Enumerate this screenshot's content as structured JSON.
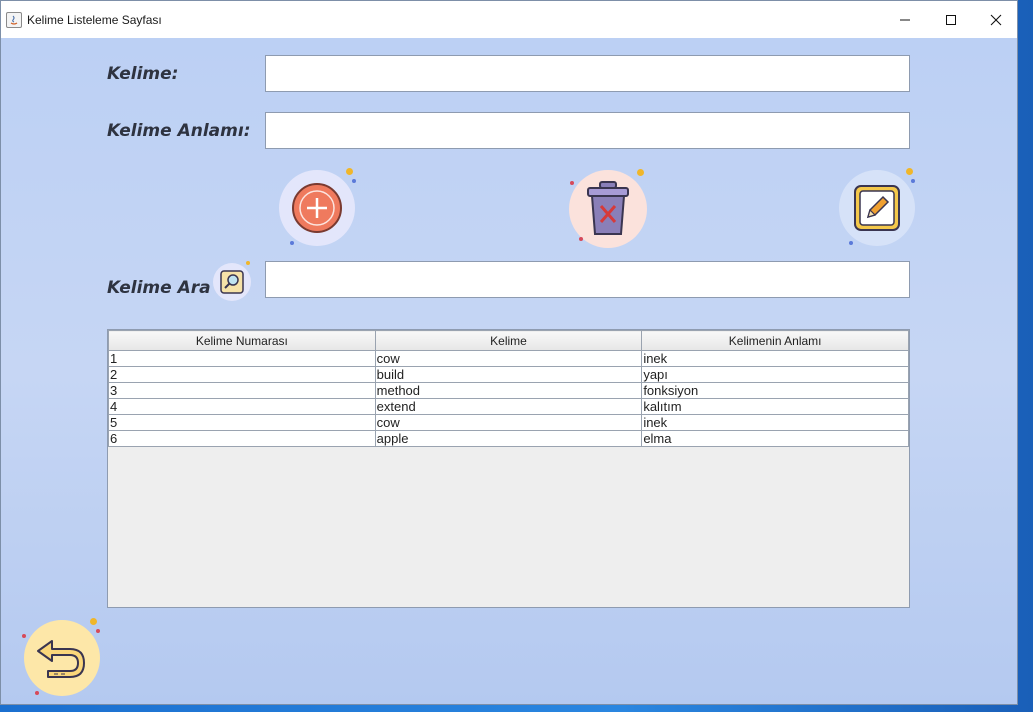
{
  "window": {
    "title": "Kelime Listeleme Sayfası",
    "controls": {
      "minimize": "minimize-icon",
      "maximize": "maximize-icon",
      "close": "close-icon"
    }
  },
  "form": {
    "word_label": "Kelime:",
    "word_value": "",
    "meaning_label": "Kelime Anlamı:",
    "meaning_value": "",
    "search_label": "Kelime Ara",
    "search_value": ""
  },
  "actions": {
    "add": "add-icon",
    "delete": "trash-delete-icon",
    "edit": "edit-pencil-icon",
    "back": "back-arrow-icon"
  },
  "table": {
    "columns": [
      "Kelime Numarası",
      "Kelime",
      "Kelimenin Anlamı"
    ],
    "rows": [
      [
        "1",
        "cow",
        "inek"
      ],
      [
        "2",
        "build",
        "yapı"
      ],
      [
        "3",
        "method",
        "fonksiyon"
      ],
      [
        "4",
        "extend",
        "kalıtım"
      ],
      [
        "5",
        "cow",
        "inek"
      ],
      [
        "6",
        "apple",
        "elma"
      ]
    ]
  },
  "colors": {
    "background": "#bcd0f4",
    "add_button": "#ef7a5e",
    "delete_button": "#8a7fb8",
    "edit_button": "#f4c84a",
    "back_button": "#fde7a8"
  }
}
